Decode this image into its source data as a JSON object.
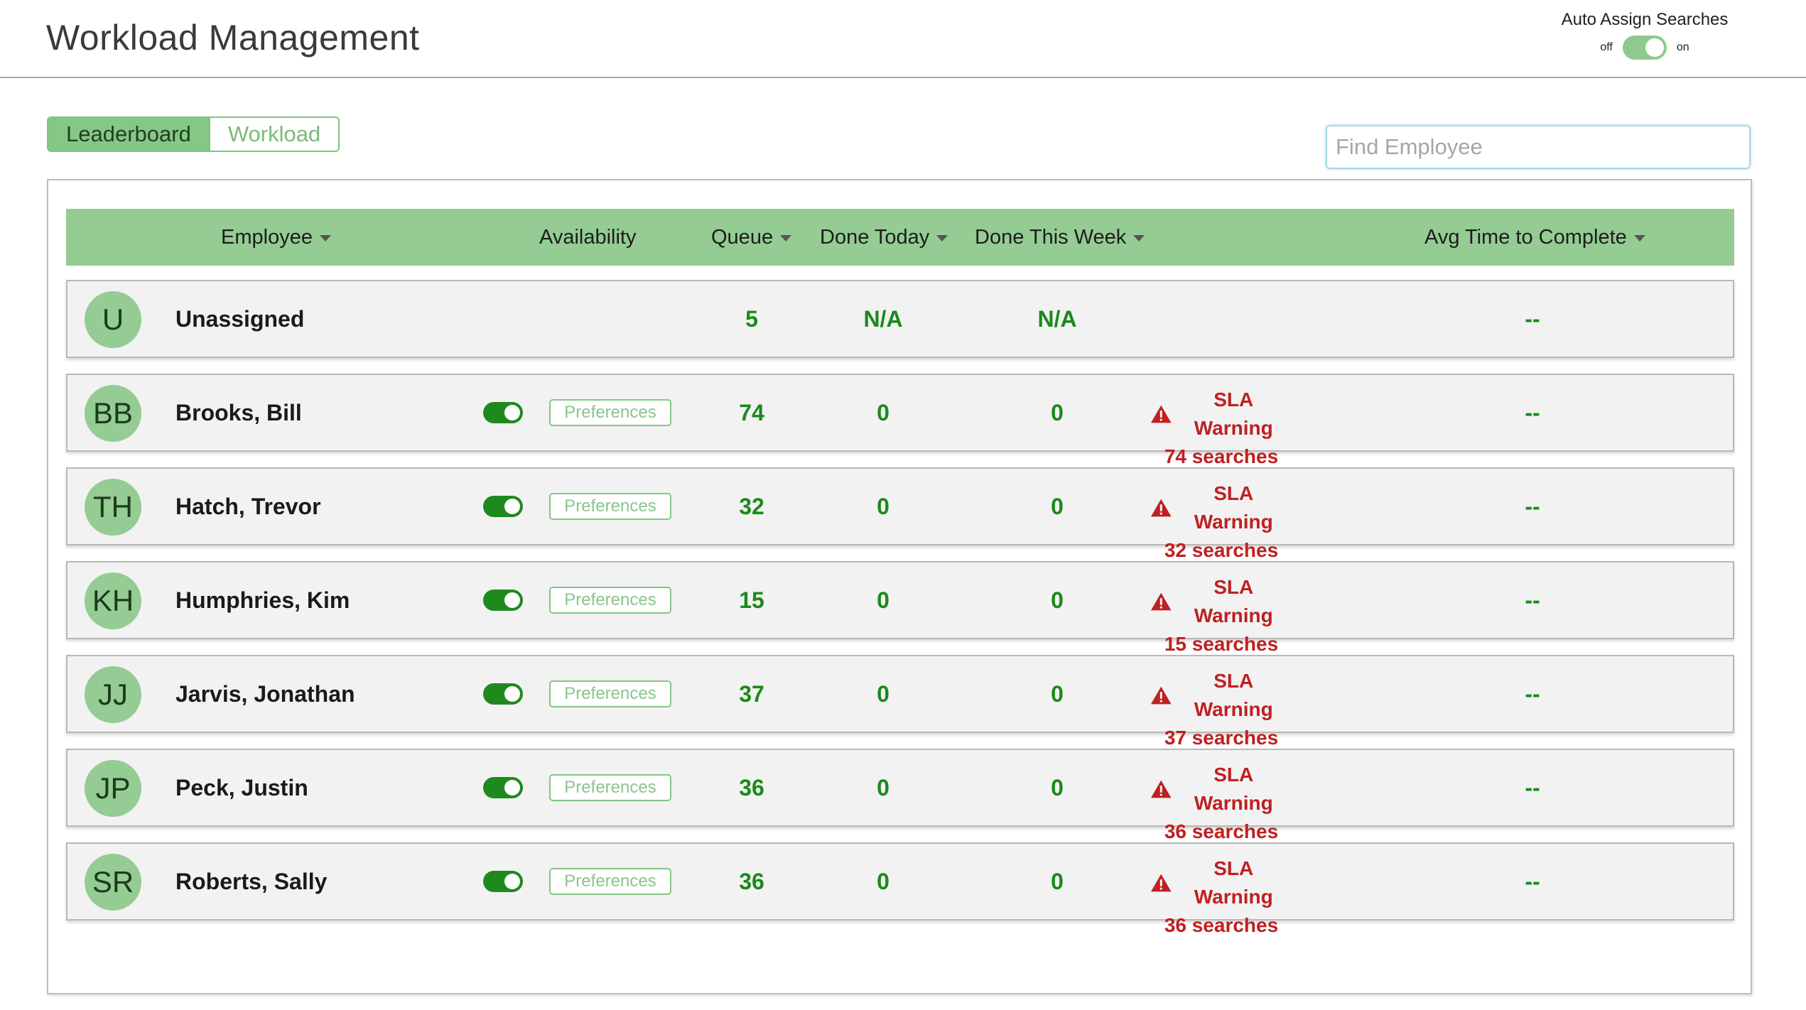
{
  "header": {
    "title": "Workload Management",
    "auto_assign_label": "Auto Assign Searches",
    "auto_assign_off": "off",
    "auto_assign_on": "on"
  },
  "tabs": [
    {
      "label": "Leaderboard",
      "active": true
    },
    {
      "label": "Workload",
      "active": false
    }
  ],
  "search": {
    "placeholder": "Find Employee",
    "value": ""
  },
  "columns": {
    "employee": "Employee",
    "availability": "Availability",
    "queue": "Queue",
    "done_today": "Done Today",
    "done_week": "Done This Week",
    "avg_time": "Avg Time to Complete"
  },
  "prefs_label": "Preferences",
  "rows": [
    {
      "initials": "U",
      "name": "Unassigned",
      "queue": "5",
      "done_today": "N/A",
      "done_week": "N/A",
      "sla_title": "",
      "sla_count": "",
      "avg": "--"
    },
    {
      "initials": "BB",
      "name": "Brooks, Bill",
      "queue": "74",
      "done_today": "0",
      "done_week": "0",
      "sla_title": "SLA Warning",
      "sla_count": "74 searches",
      "avg": "--"
    },
    {
      "initials": "TH",
      "name": "Hatch, Trevor",
      "queue": "32",
      "done_today": "0",
      "done_week": "0",
      "sla_title": "SLA Warning",
      "sla_count": "32 searches",
      "avg": "--"
    },
    {
      "initials": "KH",
      "name": "Humphries, Kim",
      "queue": "15",
      "done_today": "0",
      "done_week": "0",
      "sla_title": "SLA Warning",
      "sla_count": "15 searches",
      "avg": "--"
    },
    {
      "initials": "JJ",
      "name": "Jarvis, Jonathan",
      "queue": "37",
      "done_today": "0",
      "done_week": "0",
      "sla_title": "SLA Warning",
      "sla_count": "37 searches",
      "avg": "--"
    },
    {
      "initials": "JP",
      "name": "Peck, Justin",
      "queue": "36",
      "done_today": "0",
      "done_week": "0",
      "sla_title": "SLA Warning",
      "sla_count": "36 searches",
      "avg": "--"
    },
    {
      "initials": "SR",
      "name": "Roberts, Sally",
      "queue": "36",
      "done_today": "0",
      "done_week": "0",
      "sla_title": "SLA Warning",
      "sla_count": "36 searches",
      "avg": "--"
    }
  ],
  "colors": {
    "accent_green": "#94cc94",
    "value_green": "#1a8a1a",
    "toggle_green": "#1e8a1e",
    "warning_red": "#c02020"
  }
}
